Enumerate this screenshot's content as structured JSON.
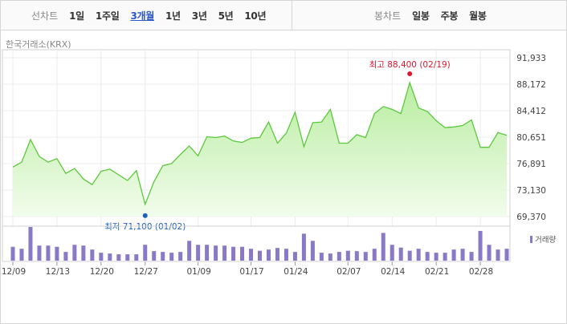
{
  "tabs": {
    "line_label": "선차트",
    "line_items": [
      "1일",
      "1주일",
      "3개월",
      "1년",
      "3년",
      "5년",
      "10년"
    ],
    "active": "3개월",
    "candle_label": "봉차트",
    "candle_items": [
      "일봉",
      "주봉",
      "월봉"
    ]
  },
  "source": "한국거래소(KRX)",
  "volume_label": "거래량",
  "colors": {
    "line": "#5cc93c",
    "fill_top": "#b8eda0",
    "fill_bottom": "#f2fcec",
    "volume": "#8a79c6",
    "max_marker": "#e0182d",
    "min_marker": "#1f5fc2",
    "active_tab": "#2a57c9"
  },
  "chart_data": {
    "type": "area",
    "y_ticks": [
      "91,933",
      "88,172",
      "84,412",
      "80,651",
      "76,891",
      "73,130",
      "69,370"
    ],
    "ylim": [
      69370,
      91933
    ],
    "x_tick_labels": [
      "12/09",
      "12/13",
      "12/20",
      "12/27",
      "01/09",
      "01/17",
      "01/24",
      "02/07",
      "02/14",
      "02/21",
      "02/28"
    ],
    "x_tick_index": [
      0,
      5,
      10,
      15,
      21,
      27,
      32,
      38,
      43,
      48,
      53
    ],
    "price": [
      76400,
      77100,
      80300,
      77900,
      77100,
      77600,
      75500,
      76200,
      74700,
      73900,
      75800,
      76100,
      75300,
      74500,
      75900,
      71100,
      74300,
      76600,
      76900,
      78200,
      79400,
      78000,
      80700,
      80600,
      80800,
      80100,
      79900,
      80500,
      80600,
      82800,
      79800,
      81200,
      84200,
      79300,
      82700,
      82800,
      84600,
      79800,
      79800,
      81000,
      80600,
      84000,
      85000,
      84600,
      84000,
      88400,
      84800,
      84300,
      83000,
      82000,
      82100,
      82300,
      83100,
      79200,
      79200,
      81300,
      80900
    ],
    "volume": [
      35,
      30,
      85,
      38,
      38,
      35,
      22,
      40,
      38,
      28,
      20,
      18,
      16,
      16,
      16,
      40,
      24,
      22,
      20,
      22,
      50,
      40,
      40,
      38,
      38,
      35,
      35,
      30,
      25,
      28,
      32,
      30,
      22,
      68,
      50,
      20,
      18,
      22,
      25,
      24,
      22,
      30,
      70,
      40,
      33,
      25,
      30,
      22,
      20,
      20,
      28,
      30,
      22,
      75,
      40,
      28,
      30
    ],
    "max_annotation": {
      "label": "최고 88,400 (02/19)",
      "value": 88400,
      "index": 45
    },
    "min_annotation": {
      "label": "최저 71,100 (01/02)",
      "value": 71100,
      "index": 15
    },
    "grid": true,
    "legend": "volume label right of volume panel"
  }
}
